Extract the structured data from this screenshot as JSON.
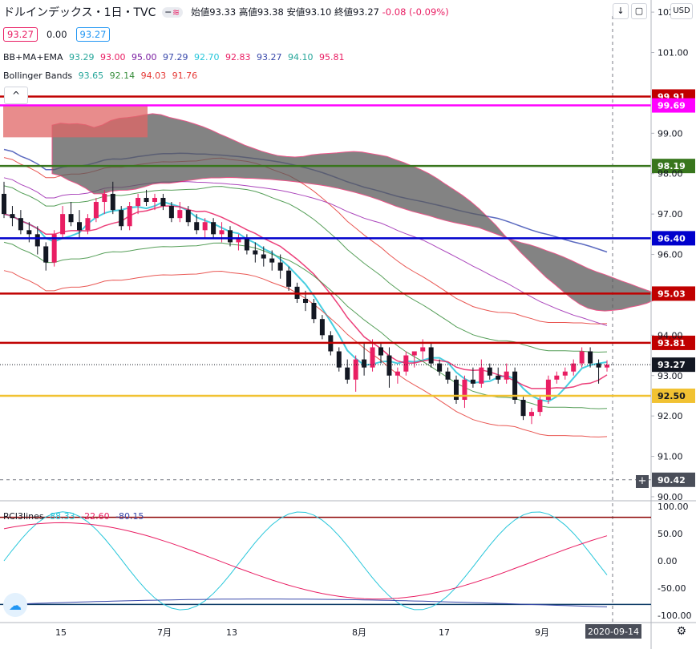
{
  "header": {
    "title": "ドルインデックス・1日・TVC",
    "open_label": "始値",
    "open": "93.33",
    "high_label": "高値",
    "high": "93.38",
    "low_label": "安値",
    "low": "93.10",
    "close_label": "終値",
    "close": "93.27",
    "change": "-0.08 (-0.09%)"
  },
  "pricebox": {
    "bid": "93.27",
    "spread": "0.00",
    "ask": "93.27"
  },
  "legend_bb_ma_ema": {
    "name": "BB+MA+EMA",
    "values": [
      "93.29",
      "93.00",
      "95.00",
      "97.29",
      "92.70",
      "92.83",
      "93.27",
      "94.10",
      "95.81"
    ]
  },
  "legend_bollinger": {
    "name": "Bollinger Bands",
    "values": [
      "93.65",
      "92.14",
      "94.03",
      "91.76"
    ]
  },
  "legend_rci": {
    "name": "RCI3lines",
    "values": [
      "88.33",
      "-22.60",
      "-80.15"
    ]
  },
  "axis_currency": "USD",
  "date_badge": "2020-09-14",
  "colors": {
    "up": "#e91e63",
    "down": "#131722",
    "cloud_dark": "#5a5a5a",
    "cloud_red": "#e06666",
    "line_red": "#c00000",
    "line_magenta": "#ff00ff",
    "line_green": "#38761d",
    "line_blue": "#0000cc",
    "line_gold": "#f1c232"
  },
  "chart_data": {
    "type": "candlestick",
    "y_ticks": [
      102.0,
      101.0,
      99.0,
      98.0,
      97.0,
      96.0,
      94.0,
      93.0,
      92.0,
      91.0,
      90.0
    ],
    "ylim": [
      89.9,
      102.3
    ],
    "x_tick_labels": [
      "15",
      "7月",
      "13",
      "8月",
      "17",
      "9月"
    ],
    "horizontal_levels": [
      {
        "value": 99.91,
        "label": "99.91",
        "color": "#c00000"
      },
      {
        "value": 99.69,
        "label": "99.69",
        "color": "#ff00ff"
      },
      {
        "value": 98.19,
        "label": "98.19",
        "color": "#38761d"
      },
      {
        "value": 96.4,
        "label": "96.40",
        "color": "#0000cc"
      },
      {
        "value": 95.03,
        "label": "95.03",
        "color": "#c00000"
      },
      {
        "value": 93.81,
        "label": "93.81",
        "color": "#c00000"
      },
      {
        "value": 92.5,
        "label": "92.50",
        "color": "#f1c232"
      }
    ],
    "last_price": {
      "value": 93.27,
      "label": "93.27"
    },
    "crosshair": {
      "value": 90.42,
      "label": "90.42"
    },
    "candles": [
      [
        97.5,
        97.8,
        96.9,
        97.0
      ],
      [
        97.0,
        97.2,
        96.7,
        96.9
      ],
      [
        96.9,
        97.1,
        96.5,
        96.6
      ],
      [
        96.6,
        96.8,
        96.3,
        96.5
      ],
      [
        96.5,
        96.7,
        96.0,
        96.2
      ],
      [
        96.2,
        96.3,
        95.6,
        95.8
      ],
      [
        95.8,
        96.6,
        95.7,
        96.5
      ],
      [
        96.5,
        97.2,
        96.4,
        97.0
      ],
      [
        97.0,
        97.3,
        96.7,
        96.8
      ],
      [
        96.8,
        97.1,
        96.4,
        96.6
      ],
      [
        96.6,
        97.0,
        96.5,
        96.9
      ],
      [
        96.9,
        97.4,
        96.8,
        97.3
      ],
      [
        97.3,
        97.6,
        97.0,
        97.5
      ],
      [
        97.5,
        97.8,
        97.0,
        97.1
      ],
      [
        97.1,
        97.2,
        96.6,
        96.7
      ],
      [
        96.7,
        97.3,
        96.6,
        97.2
      ],
      [
        97.2,
        97.5,
        97.0,
        97.4
      ],
      [
        97.4,
        97.6,
        97.2,
        97.3
      ],
      [
        97.3,
        97.5,
        97.1,
        97.4
      ],
      [
        97.4,
        97.5,
        97.1,
        97.2
      ],
      [
        97.2,
        97.3,
        96.8,
        96.9
      ],
      [
        96.9,
        97.3,
        96.8,
        97.1
      ],
      [
        97.1,
        97.2,
        96.7,
        96.8
      ],
      [
        96.8,
        97.0,
        96.5,
        96.6
      ],
      [
        96.6,
        96.9,
        96.4,
        96.8
      ],
      [
        96.8,
        96.9,
        96.4,
        96.5
      ],
      [
        96.5,
        96.8,
        96.3,
        96.6
      ],
      [
        96.6,
        96.7,
        96.2,
        96.3
      ],
      [
        96.3,
        96.5,
        96.1,
        96.4
      ],
      [
        96.4,
        96.5,
        96.0,
        96.1
      ],
      [
        96.1,
        96.3,
        95.8,
        96.0
      ],
      [
        96.0,
        96.2,
        95.7,
        95.9
      ],
      [
        95.9,
        96.1,
        95.6,
        95.8
      ],
      [
        95.8,
        96.0,
        95.4,
        95.6
      ],
      [
        95.6,
        95.7,
        95.1,
        95.2
      ],
      [
        95.2,
        95.3,
        94.8,
        94.9
      ],
      [
        94.9,
        95.1,
        94.6,
        94.8
      ],
      [
        94.8,
        94.9,
        94.3,
        94.4
      ],
      [
        94.4,
        94.5,
        93.9,
        94.0
      ],
      [
        94.0,
        94.1,
        93.5,
        93.6
      ],
      [
        93.6,
        93.7,
        93.1,
        93.2
      ],
      [
        93.2,
        93.4,
        92.8,
        92.9
      ],
      [
        92.9,
        93.5,
        92.6,
        93.4
      ],
      [
        93.4,
        93.8,
        93.0,
        93.2
      ],
      [
        93.2,
        93.9,
        93.1,
        93.7
      ],
      [
        93.7,
        93.8,
        93.3,
        93.5
      ],
      [
        93.5,
        93.7,
        92.7,
        93.0
      ],
      [
        93.0,
        93.2,
        92.8,
        93.1
      ],
      [
        93.1,
        93.6,
        93.0,
        93.5
      ],
      [
        93.5,
        93.6,
        93.2,
        93.6
      ],
      [
        93.6,
        93.9,
        93.4,
        93.7
      ],
      [
        93.7,
        93.8,
        93.2,
        93.3
      ],
      [
        93.3,
        93.4,
        93.0,
        93.1
      ],
      [
        93.1,
        93.2,
        92.8,
        92.9
      ],
      [
        92.9,
        93.0,
        92.3,
        92.4
      ],
      [
        92.4,
        93.0,
        92.2,
        92.9
      ],
      [
        92.9,
        93.2,
        92.7,
        92.8
      ],
      [
        92.8,
        93.4,
        92.7,
        93.2
      ],
      [
        93.2,
        93.3,
        92.9,
        93.0
      ],
      [
        93.0,
        93.2,
        92.8,
        92.9
      ],
      [
        92.9,
        93.3,
        92.8,
        93.1
      ],
      [
        93.1,
        93.2,
        92.3,
        92.4
      ],
      [
        92.4,
        92.5,
        91.9,
        92.0
      ],
      [
        92.0,
        92.2,
        91.8,
        92.1
      ],
      [
        92.1,
        92.5,
        92.0,
        92.4
      ],
      [
        92.4,
        93.0,
        92.3,
        92.9
      ],
      [
        92.9,
        93.1,
        92.8,
        93.0
      ],
      [
        93.0,
        93.2,
        92.9,
        93.1
      ],
      [
        93.1,
        93.4,
        93.0,
        93.3
      ],
      [
        93.3,
        93.7,
        93.2,
        93.6
      ],
      [
        93.6,
        93.7,
        93.2,
        93.3
      ],
      [
        93.3,
        93.4,
        92.8,
        93.2
      ],
      [
        93.2,
        93.38,
        93.1,
        93.27
      ]
    ]
  }
}
